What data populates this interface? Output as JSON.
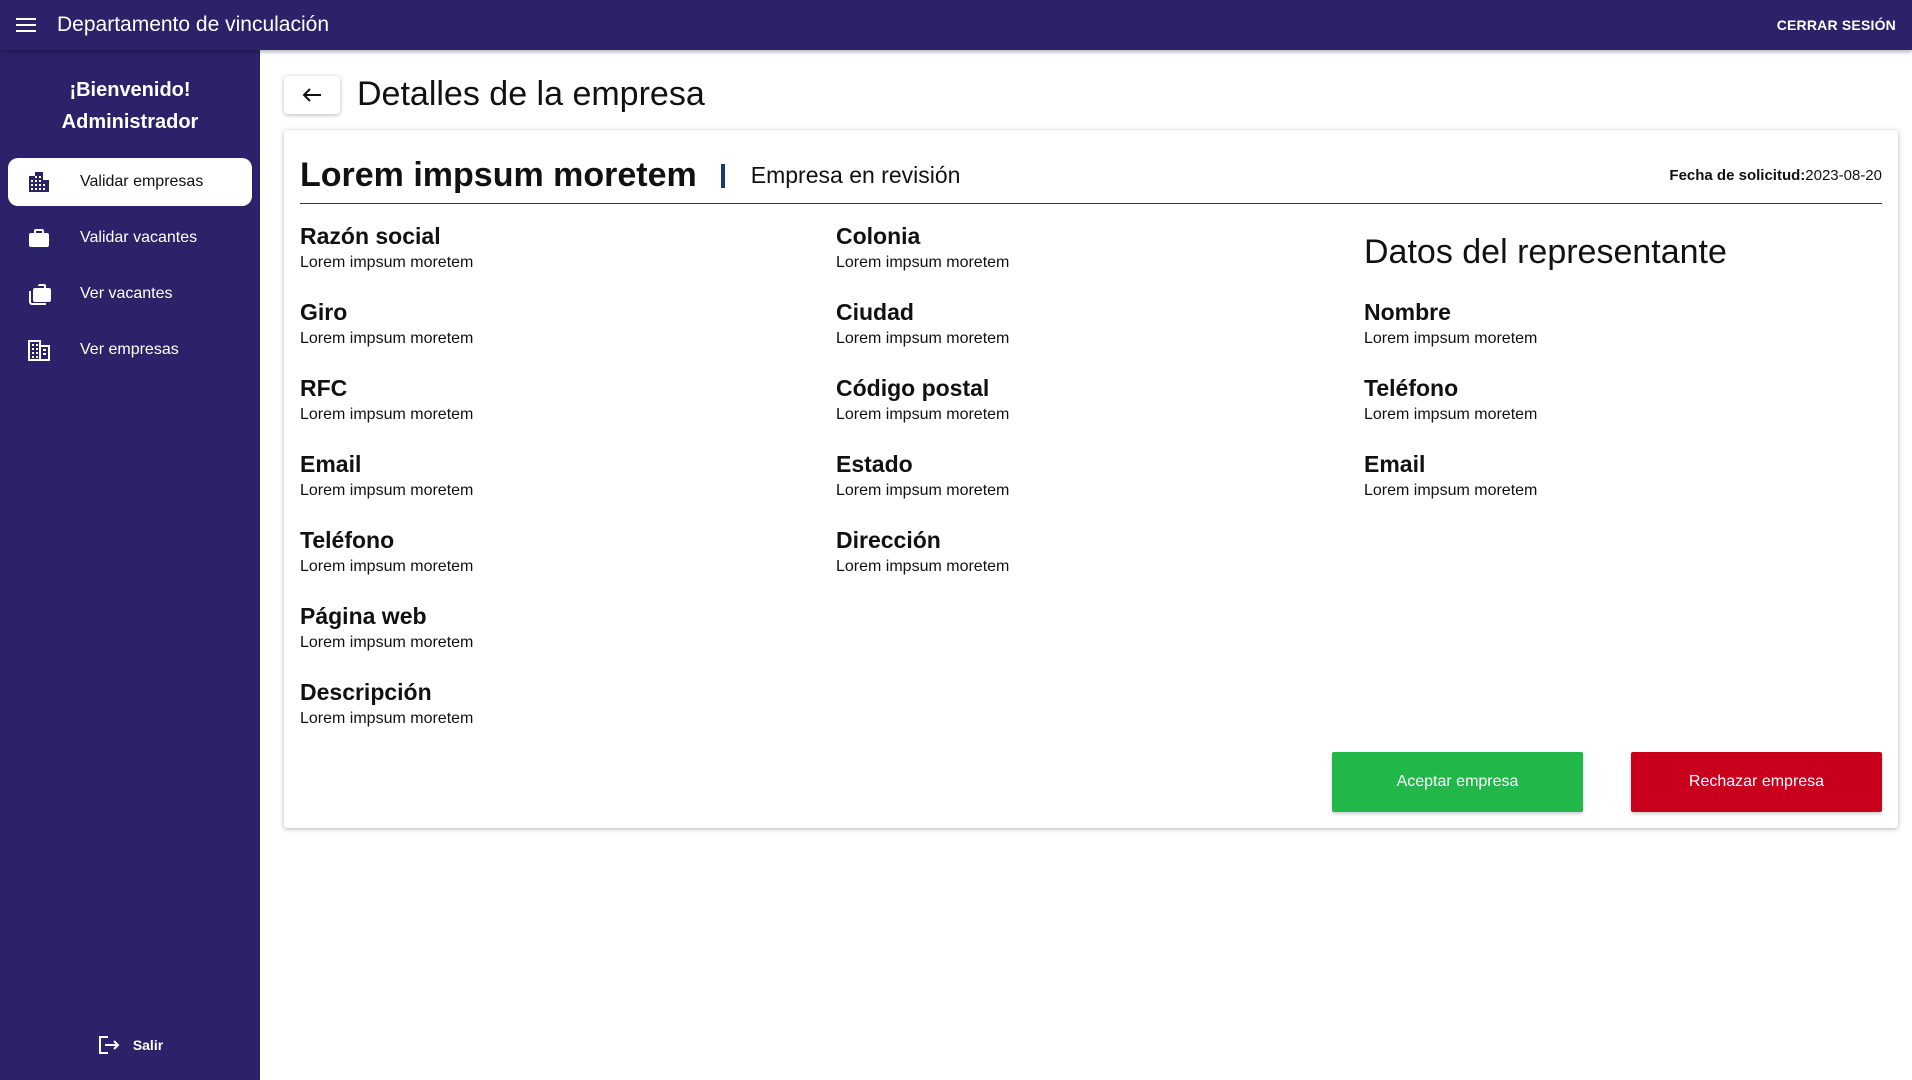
{
  "appbar": {
    "title": "Departamento de vinculación",
    "logout_label": "CERRAR SESIÓN"
  },
  "sidebar": {
    "welcome_line1": "¡Bienvenido!",
    "welcome_line2": "Administrador",
    "items": [
      {
        "label": "Validar empresas",
        "icon": "buildings-icon",
        "active": true
      },
      {
        "label": "Validar vacantes",
        "icon": "briefcase-icon",
        "active": false
      },
      {
        "label": "Ver vacantes",
        "icon": "briefcases-icon",
        "active": false
      },
      {
        "label": "Ver empresas",
        "icon": "company-icon",
        "active": false
      }
    ],
    "exit_label": "Salir"
  },
  "page": {
    "title": "Detalles de la empresa"
  },
  "company": {
    "name": "Lorem impsum moretem",
    "status": "Empresa en revisión",
    "request_date_label": "Fecha de solicitud:",
    "request_date": "2023-08-20"
  },
  "left_fields": [
    {
      "label": "Razón social",
      "value": "Lorem impsum moretem"
    },
    {
      "label": "Giro",
      "value": "Lorem impsum moretem"
    },
    {
      "label": "RFC",
      "value": "Lorem impsum moretem"
    },
    {
      "label": "Email",
      "value": "Lorem impsum moretem"
    },
    {
      "label": "Teléfono",
      "value": "Lorem impsum moretem"
    },
    {
      "label": "Página web",
      "value": "Lorem impsum moretem"
    },
    {
      "label": "Descripción",
      "value": "Lorem impsum moretem"
    }
  ],
  "middle_fields": [
    {
      "label": "Colonia",
      "value": "Lorem impsum moretem"
    },
    {
      "label": "Ciudad",
      "value": "Lorem impsum moretem"
    },
    {
      "label": "Código postal",
      "value": "Lorem impsum moretem"
    },
    {
      "label": "Estado",
      "value": "Lorem impsum moretem"
    },
    {
      "label": "Dirección",
      "value": "Lorem impsum moretem"
    }
  ],
  "representative": {
    "title": "Datos del representante",
    "fields": [
      {
        "label": "Nombre",
        "value": "Lorem impsum moretem"
      },
      {
        "label": "Teléfono",
        "value": "Lorem impsum moretem"
      },
      {
        "label": "Email",
        "value": "Lorem impsum moretem"
      }
    ]
  },
  "actions": {
    "accept_label": "Aceptar empresa",
    "reject_label": "Rechazar empresa"
  },
  "colors": {
    "primary": "#2c226a",
    "accept": "#21b849",
    "reject": "#c8001d",
    "divider_bar": "#1b3a6b"
  }
}
